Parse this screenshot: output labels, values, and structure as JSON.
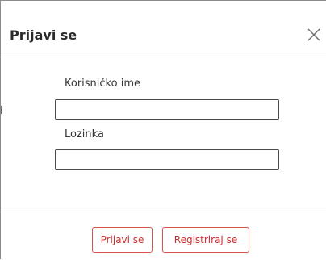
{
  "dialog": {
    "title": "Prijavi se",
    "close_icon": "close-icon"
  },
  "form": {
    "username_label": "Korisničko ime",
    "username_value": "",
    "password_label": "Lozinka",
    "password_value": ""
  },
  "footer": {
    "login_label": "Prijavi se",
    "register_label": "Registriraj se"
  },
  "colors": {
    "accent": "#d9534f",
    "text": "#333333"
  }
}
